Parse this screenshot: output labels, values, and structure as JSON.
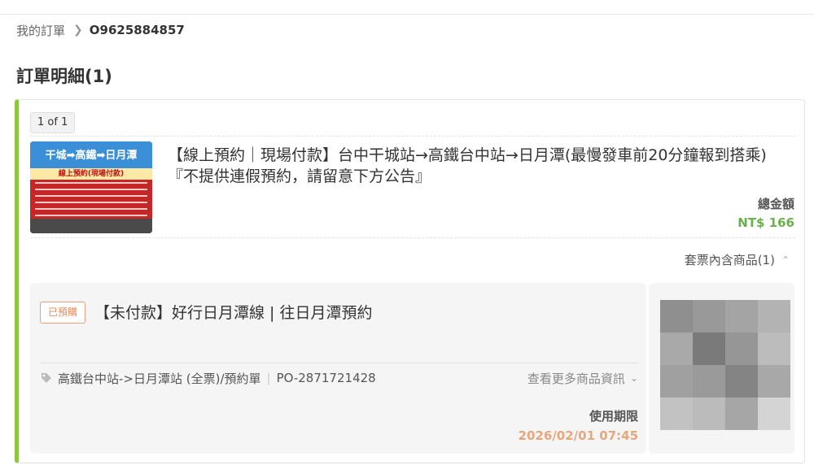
{
  "breadcrumb": {
    "home": "我的訂單",
    "order_no": "O9625884857"
  },
  "page_title": "訂單明細(1)",
  "order": {
    "pager": "1 of 1",
    "thumbnail": {
      "headline": "干城➡高鐵➡日月潭",
      "subline": "線上預約(現場付款)"
    },
    "product_title": "【線上預約｜現場付款】台中干城站→高鐵台中站→日月潭(最慢發車前20分鐘報到搭乘)『不提供連假預約，請留意下方公告』",
    "total_label": "總金額",
    "total_value": "NT$ 166",
    "bundle_label": "套票內含商品(1)",
    "ticket": {
      "status": "已預購",
      "title": "【未付款】好行日月潭線 | 往日月潭預約",
      "route": "高鐵台中站->日月潭站 (全票)/預約單",
      "po_number": "PO-2871721428",
      "more_info": "查看更多商品資訊",
      "validity_label": "使用期限",
      "validity_value": "2026/02/01 07:45"
    },
    "photo_mosaic_colors": [
      "#8f8f8f",
      "#999999",
      "#a4a4a4",
      "#b3b3b3",
      "#a9a9a9",
      "#7a7a7a",
      "#969696",
      "#bcbcbc",
      "#a0a0a0",
      "#9a9a9a",
      "#848484",
      "#a8a8a8",
      "#c2c2c2",
      "#bbbbbb",
      "#a6a6a6",
      "#d4d4d4"
    ]
  },
  "colors": {
    "accent_green": "#8cc63f",
    "price_green": "#6ab04c",
    "status_orange": "#e58a5a",
    "validity_orange": "#e8a67d"
  }
}
